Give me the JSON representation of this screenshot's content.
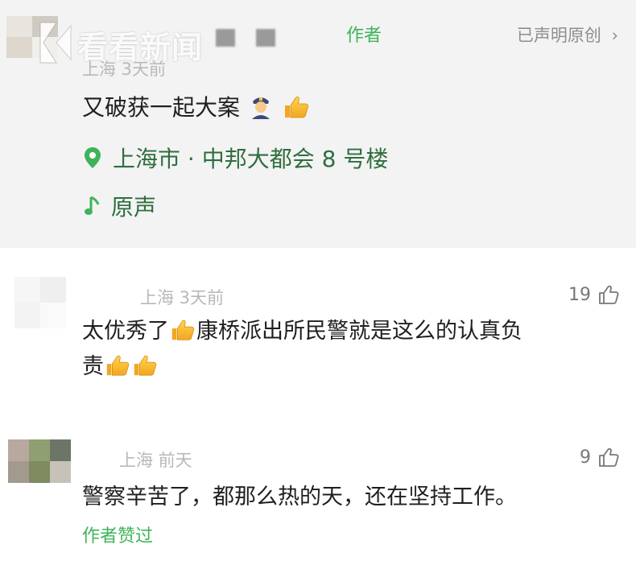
{
  "post": {
    "author_badge": "作者",
    "original_claim": "已声明原创",
    "meta": "上海 3天前",
    "text": "又破获一起大案",
    "location_icon": "location-pin-icon",
    "location": "上海市 · 中邦大都会 8 号楼",
    "sound_icon": "music-note-icon",
    "sound": "原声"
  },
  "watermark": {
    "text": "看看新闻"
  },
  "comments": [
    {
      "meta": "上海 3天前",
      "likes": "19",
      "line1": "太优秀了",
      "line1_rest": "康桥派出所民警就是这么的认真负",
      "line2": "责"
    },
    {
      "meta": "上海 前天",
      "likes": "9",
      "text": "警察辛苦了，都那么热的天，还在坚持工作。",
      "author_liked": "作者赞过"
    }
  ],
  "colors": {
    "accent_green": "#3fb35a",
    "post_bg": "#f3f3f3",
    "muted": "#b8b8b8"
  }
}
